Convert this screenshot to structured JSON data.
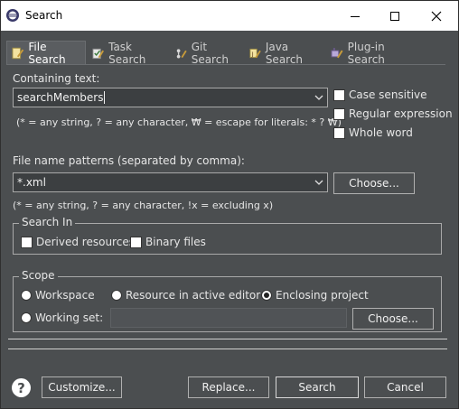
{
  "window": {
    "title": "Search",
    "app_icon": "eclipse-icon",
    "controls": [
      "minimize",
      "maximize",
      "close"
    ]
  },
  "tabs": [
    {
      "label": "File Search",
      "icon": "file-search-icon",
      "active": true
    },
    {
      "label": "Task Search",
      "icon": "task-search-icon",
      "active": false
    },
    {
      "label": "Git Search",
      "icon": "git-search-icon",
      "active": false
    },
    {
      "label": "Java Search",
      "icon": "java-search-icon",
      "active": false
    },
    {
      "label": "Plug-in Search",
      "icon": "plugin-search-icon",
      "active": false
    }
  ],
  "containing": {
    "label": "Containing text:",
    "value": "searchMembers",
    "hint": "(* = any string, ? = any character, ₩ = escape for literals: * ? ₩)"
  },
  "options": {
    "case_sensitive": "Case sensitive",
    "regex": "Regular expression",
    "whole_word": "Whole word"
  },
  "patterns": {
    "label": "File name patterns (separated by comma):",
    "value": "*.xml",
    "choose": "Choose...",
    "hint": "(* = any string, ? = any character, !x = excluding x)"
  },
  "search_in": {
    "legend": "Search In",
    "derived": "Derived resources",
    "binary": "Binary files"
  },
  "scope": {
    "legend": "Scope",
    "workspace": "Workspace",
    "active_editor": "Resource in active editor",
    "enclosing": "Enclosing project",
    "working_set": "Working set:",
    "choose": "Choose...",
    "selected": "enclosing"
  },
  "footer": {
    "customize": "Customize...",
    "replace": "Replace...",
    "search": "Search",
    "cancel": "Cancel"
  }
}
